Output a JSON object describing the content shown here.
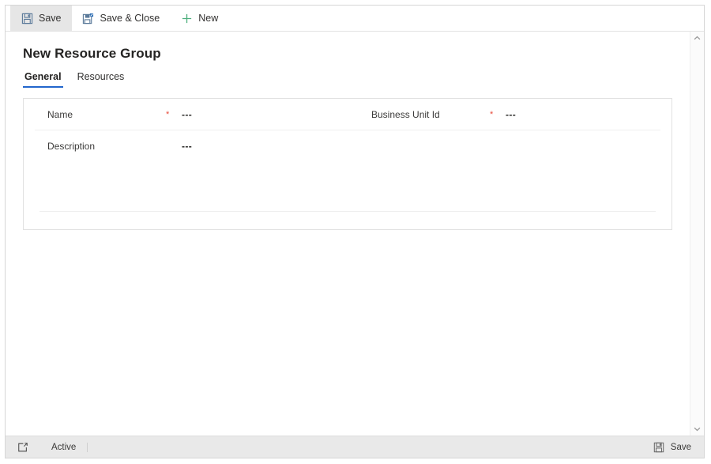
{
  "window": {
    "title": "New Resource Group"
  },
  "command_bar": {
    "buttons": [
      {
        "label": "Save",
        "icon": "save-icon",
        "active": true
      },
      {
        "label": "Save & Close",
        "icon": "save-and-close-icon",
        "active": false
      },
      {
        "label": "New",
        "icon": "plus-icon",
        "active": false
      }
    ]
  },
  "tabs": [
    {
      "label": "General",
      "selected": true
    },
    {
      "label": "Resources",
      "selected": false
    }
  ],
  "form": {
    "fields": [
      {
        "label": "Name",
        "required": true,
        "required_mark": "*",
        "value": "---"
      },
      {
        "label": "Business Unit Id",
        "required": true,
        "required_mark": "*",
        "value": "---"
      },
      {
        "label": "Description",
        "required": false,
        "required_mark": "",
        "value": "---"
      }
    ]
  },
  "scrollbar": {
    "up_icon": "chevron-up-icon",
    "down_icon": "chevron-down-icon"
  },
  "status_bar": {
    "icon": "open-in-new-window-icon",
    "state": "Active",
    "save_label": "Save",
    "save_icon": "save-icon"
  },
  "colors": {
    "accent": "#2266cc",
    "required": "#e74c3c",
    "new_icon": "#4caf7d",
    "save_icon": "#5b7a9a",
    "status_bar_bg": "#e9e9e9"
  }
}
